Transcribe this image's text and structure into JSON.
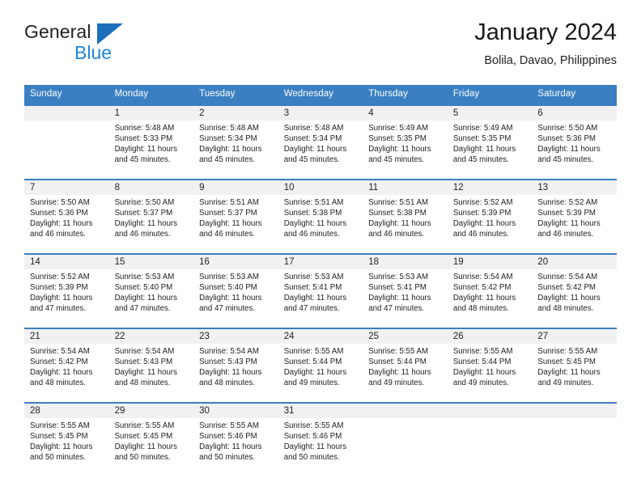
{
  "brand": {
    "name_top": "General",
    "name_bottom": "Blue",
    "triangle_color": "#1c6fba",
    "blue_color": "#1f86d8"
  },
  "header": {
    "title": "January 2024",
    "subtitle": "Bolila, Davao, Philippines"
  },
  "theme": {
    "header_band": "#3a7fc1",
    "date_band": "#f1f1f1",
    "row_rule": "#3a7fc1",
    "text": "#1e1e1e"
  },
  "weekdays": [
    "Sunday",
    "Monday",
    "Tuesday",
    "Wednesday",
    "Thursday",
    "Friday",
    "Saturday"
  ],
  "weeks": [
    [
      {
        "date": "",
        "sunrise": "",
        "sunset": "",
        "daylight": "",
        "empty": true
      },
      {
        "date": "1",
        "sunrise": "Sunrise: 5:48 AM",
        "sunset": "Sunset: 5:33 PM",
        "daylight": "Daylight: 11 hours and 45 minutes."
      },
      {
        "date": "2",
        "sunrise": "Sunrise: 5:48 AM",
        "sunset": "Sunset: 5:34 PM",
        "daylight": "Daylight: 11 hours and 45 minutes."
      },
      {
        "date": "3",
        "sunrise": "Sunrise: 5:48 AM",
        "sunset": "Sunset: 5:34 PM",
        "daylight": "Daylight: 11 hours and 45 minutes."
      },
      {
        "date": "4",
        "sunrise": "Sunrise: 5:49 AM",
        "sunset": "Sunset: 5:35 PM",
        "daylight": "Daylight: 11 hours and 45 minutes."
      },
      {
        "date": "5",
        "sunrise": "Sunrise: 5:49 AM",
        "sunset": "Sunset: 5:35 PM",
        "daylight": "Daylight: 11 hours and 45 minutes."
      },
      {
        "date": "6",
        "sunrise": "Sunrise: 5:50 AM",
        "sunset": "Sunset: 5:36 PM",
        "daylight": "Daylight: 11 hours and 45 minutes."
      }
    ],
    [
      {
        "date": "7",
        "sunrise": "Sunrise: 5:50 AM",
        "sunset": "Sunset: 5:36 PM",
        "daylight": "Daylight: 11 hours and 46 minutes."
      },
      {
        "date": "8",
        "sunrise": "Sunrise: 5:50 AM",
        "sunset": "Sunset: 5:37 PM",
        "daylight": "Daylight: 11 hours and 46 minutes."
      },
      {
        "date": "9",
        "sunrise": "Sunrise: 5:51 AM",
        "sunset": "Sunset: 5:37 PM",
        "daylight": "Daylight: 11 hours and 46 minutes."
      },
      {
        "date": "10",
        "sunrise": "Sunrise: 5:51 AM",
        "sunset": "Sunset: 5:38 PM",
        "daylight": "Daylight: 11 hours and 46 minutes."
      },
      {
        "date": "11",
        "sunrise": "Sunrise: 5:51 AM",
        "sunset": "Sunset: 5:38 PM",
        "daylight": "Daylight: 11 hours and 46 minutes."
      },
      {
        "date": "12",
        "sunrise": "Sunrise: 5:52 AM",
        "sunset": "Sunset: 5:39 PM",
        "daylight": "Daylight: 11 hours and 46 minutes."
      },
      {
        "date": "13",
        "sunrise": "Sunrise: 5:52 AM",
        "sunset": "Sunset: 5:39 PM",
        "daylight": "Daylight: 11 hours and 46 minutes."
      }
    ],
    [
      {
        "date": "14",
        "sunrise": "Sunrise: 5:52 AM",
        "sunset": "Sunset: 5:39 PM",
        "daylight": "Daylight: 11 hours and 47 minutes."
      },
      {
        "date": "15",
        "sunrise": "Sunrise: 5:53 AM",
        "sunset": "Sunset: 5:40 PM",
        "daylight": "Daylight: 11 hours and 47 minutes."
      },
      {
        "date": "16",
        "sunrise": "Sunrise: 5:53 AM",
        "sunset": "Sunset: 5:40 PM",
        "daylight": "Daylight: 11 hours and 47 minutes."
      },
      {
        "date": "17",
        "sunrise": "Sunrise: 5:53 AM",
        "sunset": "Sunset: 5:41 PM",
        "daylight": "Daylight: 11 hours and 47 minutes."
      },
      {
        "date": "18",
        "sunrise": "Sunrise: 5:53 AM",
        "sunset": "Sunset: 5:41 PM",
        "daylight": "Daylight: 11 hours and 47 minutes."
      },
      {
        "date": "19",
        "sunrise": "Sunrise: 5:54 AM",
        "sunset": "Sunset: 5:42 PM",
        "daylight": "Daylight: 11 hours and 48 minutes."
      },
      {
        "date": "20",
        "sunrise": "Sunrise: 5:54 AM",
        "sunset": "Sunset: 5:42 PM",
        "daylight": "Daylight: 11 hours and 48 minutes."
      }
    ],
    [
      {
        "date": "21",
        "sunrise": "Sunrise: 5:54 AM",
        "sunset": "Sunset: 5:42 PM",
        "daylight": "Daylight: 11 hours and 48 minutes."
      },
      {
        "date": "22",
        "sunrise": "Sunrise: 5:54 AM",
        "sunset": "Sunset: 5:43 PM",
        "daylight": "Daylight: 11 hours and 48 minutes."
      },
      {
        "date": "23",
        "sunrise": "Sunrise: 5:54 AM",
        "sunset": "Sunset: 5:43 PM",
        "daylight": "Daylight: 11 hours and 48 minutes."
      },
      {
        "date": "24",
        "sunrise": "Sunrise: 5:55 AM",
        "sunset": "Sunset: 5:44 PM",
        "daylight": "Daylight: 11 hours and 49 minutes."
      },
      {
        "date": "25",
        "sunrise": "Sunrise: 5:55 AM",
        "sunset": "Sunset: 5:44 PM",
        "daylight": "Daylight: 11 hours and 49 minutes."
      },
      {
        "date": "26",
        "sunrise": "Sunrise: 5:55 AM",
        "sunset": "Sunset: 5:44 PM",
        "daylight": "Daylight: 11 hours and 49 minutes."
      },
      {
        "date": "27",
        "sunrise": "Sunrise: 5:55 AM",
        "sunset": "Sunset: 5:45 PM",
        "daylight": "Daylight: 11 hours and 49 minutes."
      }
    ],
    [
      {
        "date": "28",
        "sunrise": "Sunrise: 5:55 AM",
        "sunset": "Sunset: 5:45 PM",
        "daylight": "Daylight: 11 hours and 50 minutes."
      },
      {
        "date": "29",
        "sunrise": "Sunrise: 5:55 AM",
        "sunset": "Sunset: 5:45 PM",
        "daylight": "Daylight: 11 hours and 50 minutes."
      },
      {
        "date": "30",
        "sunrise": "Sunrise: 5:55 AM",
        "sunset": "Sunset: 5:46 PM",
        "daylight": "Daylight: 11 hours and 50 minutes."
      },
      {
        "date": "31",
        "sunrise": "Sunrise: 5:55 AM",
        "sunset": "Sunset: 5:46 PM",
        "daylight": "Daylight: 11 hours and 50 minutes."
      },
      {
        "date": "",
        "sunrise": "",
        "sunset": "",
        "daylight": "",
        "empty": true
      },
      {
        "date": "",
        "sunrise": "",
        "sunset": "",
        "daylight": "",
        "empty": true
      },
      {
        "date": "",
        "sunrise": "",
        "sunset": "",
        "daylight": "",
        "empty": true
      }
    ]
  ]
}
